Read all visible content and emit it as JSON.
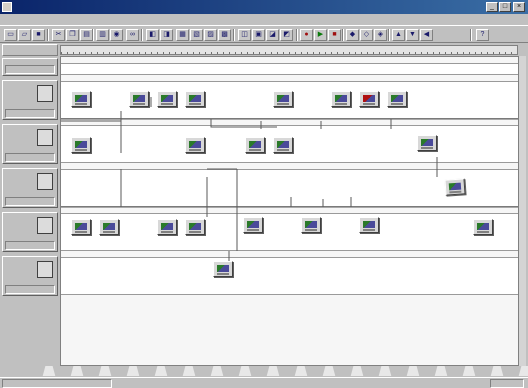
{
  "window": {
    "title": "",
    "controls": {
      "minimize": "_",
      "maximize": "□",
      "close": "×"
    }
  },
  "menu": [
    {
      "label": ""
    },
    {
      "label": ""
    },
    {
      "label": ""
    },
    {
      "label": ""
    },
    {
      "label": ""
    },
    {
      "label": ""
    },
    {
      "label": ""
    },
    {
      "label": ""
    },
    {
      "label": ""
    },
    {
      "label": ""
    }
  ],
  "toolbar": [
    {
      "name": "new-icon",
      "glyph": "▭"
    },
    {
      "name": "open-icon",
      "glyph": "▱"
    },
    {
      "name": "save-icon",
      "glyph": "■"
    },
    {
      "name": "cut-icon",
      "glyph": "✂"
    },
    {
      "name": "copy-icon",
      "glyph": "❐"
    },
    {
      "name": "paste-icon",
      "glyph": "▤"
    },
    {
      "name": "print-icon",
      "glyph": "▥"
    },
    {
      "name": "zoom-icon",
      "glyph": "◉"
    },
    {
      "name": "binoculars-icon",
      "glyph": "∞"
    },
    {
      "name": "tool-icon",
      "glyph": "◧"
    },
    {
      "name": "tool-icon",
      "glyph": "◨"
    },
    {
      "name": "tool-icon",
      "glyph": "▦"
    },
    {
      "name": "tool-icon",
      "glyph": "▧"
    },
    {
      "name": "tool-icon",
      "glyph": "▨"
    },
    {
      "name": "tool-icon",
      "glyph": "▩"
    },
    {
      "name": "tool-icon",
      "glyph": "◫"
    },
    {
      "name": "tool-icon",
      "glyph": "▣"
    },
    {
      "name": "tool-icon",
      "glyph": "◪"
    },
    {
      "name": "tool-icon",
      "glyph": "◩"
    },
    {
      "name": "record-icon",
      "glyph": "●"
    },
    {
      "name": "play-icon",
      "glyph": "▶"
    },
    {
      "name": "stop-icon",
      "glyph": "■"
    },
    {
      "name": "tool-icon",
      "glyph": "◆"
    },
    {
      "name": "tool-icon",
      "glyph": "◇"
    },
    {
      "name": "tool-icon",
      "glyph": "◈"
    },
    {
      "name": "tool-icon",
      "glyph": "▲"
    },
    {
      "name": "tool-icon",
      "glyph": "▼"
    },
    {
      "name": "tool-icon",
      "glyph": "◀"
    },
    {
      "name": "help-icon",
      "glyph": "?"
    }
  ],
  "ruler": {
    "corner": ""
  },
  "rows": [
    {
      "label": "",
      "meta": ""
    },
    {
      "label": "",
      "meta": ""
    },
    {
      "label": "",
      "meta": ""
    },
    {
      "label": "",
      "meta": ""
    },
    {
      "label": "",
      "meta": ""
    },
    {
      "label": "",
      "meta": ""
    }
  ],
  "statusbar": {
    "left": "",
    "right": ""
  }
}
